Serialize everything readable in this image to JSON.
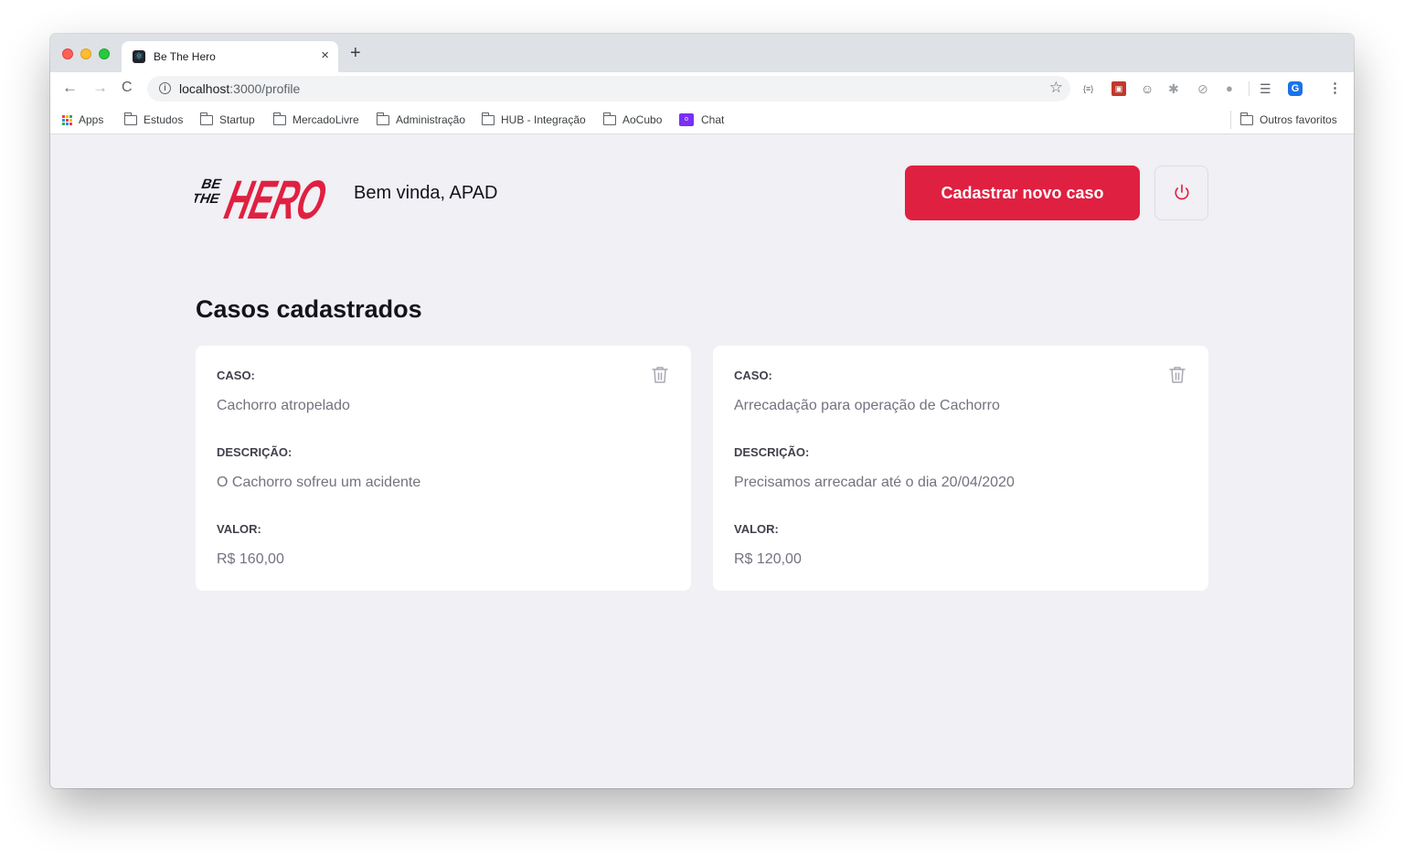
{
  "browser": {
    "tab": {
      "title": "Be The Hero",
      "favicon": "react-icon",
      "close": "×"
    },
    "new_tab": "+",
    "url": {
      "host": "localhost",
      "path": ":3000/profile"
    },
    "nav": {
      "back": "←",
      "forward": "→",
      "reload": "C"
    },
    "bookmarks": [
      {
        "label": "Apps",
        "icon": "apps-grid-icon"
      },
      {
        "label": "Estudos",
        "icon": "folder-icon"
      },
      {
        "label": "Startup",
        "icon": "folder-icon"
      },
      {
        "label": "MercadoLivre",
        "icon": "folder-icon"
      },
      {
        "label": "Administração",
        "icon": "folder-icon"
      },
      {
        "label": "HUB - Integração",
        "icon": "folder-icon"
      },
      {
        "label": "AoCubo",
        "icon": "folder-icon"
      },
      {
        "label": "Chat",
        "icon": "chat-app-icon"
      }
    ],
    "other_bookmarks": "Outros favoritos"
  },
  "header": {
    "logo_small": "BE THE",
    "logo_big": "HERO",
    "greeting": "Bem vinda, APAD",
    "new_case_label": "Cadastrar novo caso",
    "logout_icon": "power-icon"
  },
  "main": {
    "title": "Casos cadastrados",
    "labels": {
      "case": "CASO:",
      "description": "DESCRIÇÃO:",
      "value": "VALOR:"
    },
    "cases": [
      {
        "title": "Cachorro atropelado",
        "description": "O Cachorro sofreu um acidente",
        "value": "R$ 160,00"
      },
      {
        "title": "Arrecadação para operação de Cachorro",
        "description": "Precisamos arrecadar até o dia 20/04/2020",
        "value": "R$ 120,00"
      }
    ]
  },
  "colors": {
    "accent": "#e02041",
    "background": "#f0f0f5",
    "card": "#ffffff",
    "label": "#41414d",
    "value": "#737380"
  }
}
